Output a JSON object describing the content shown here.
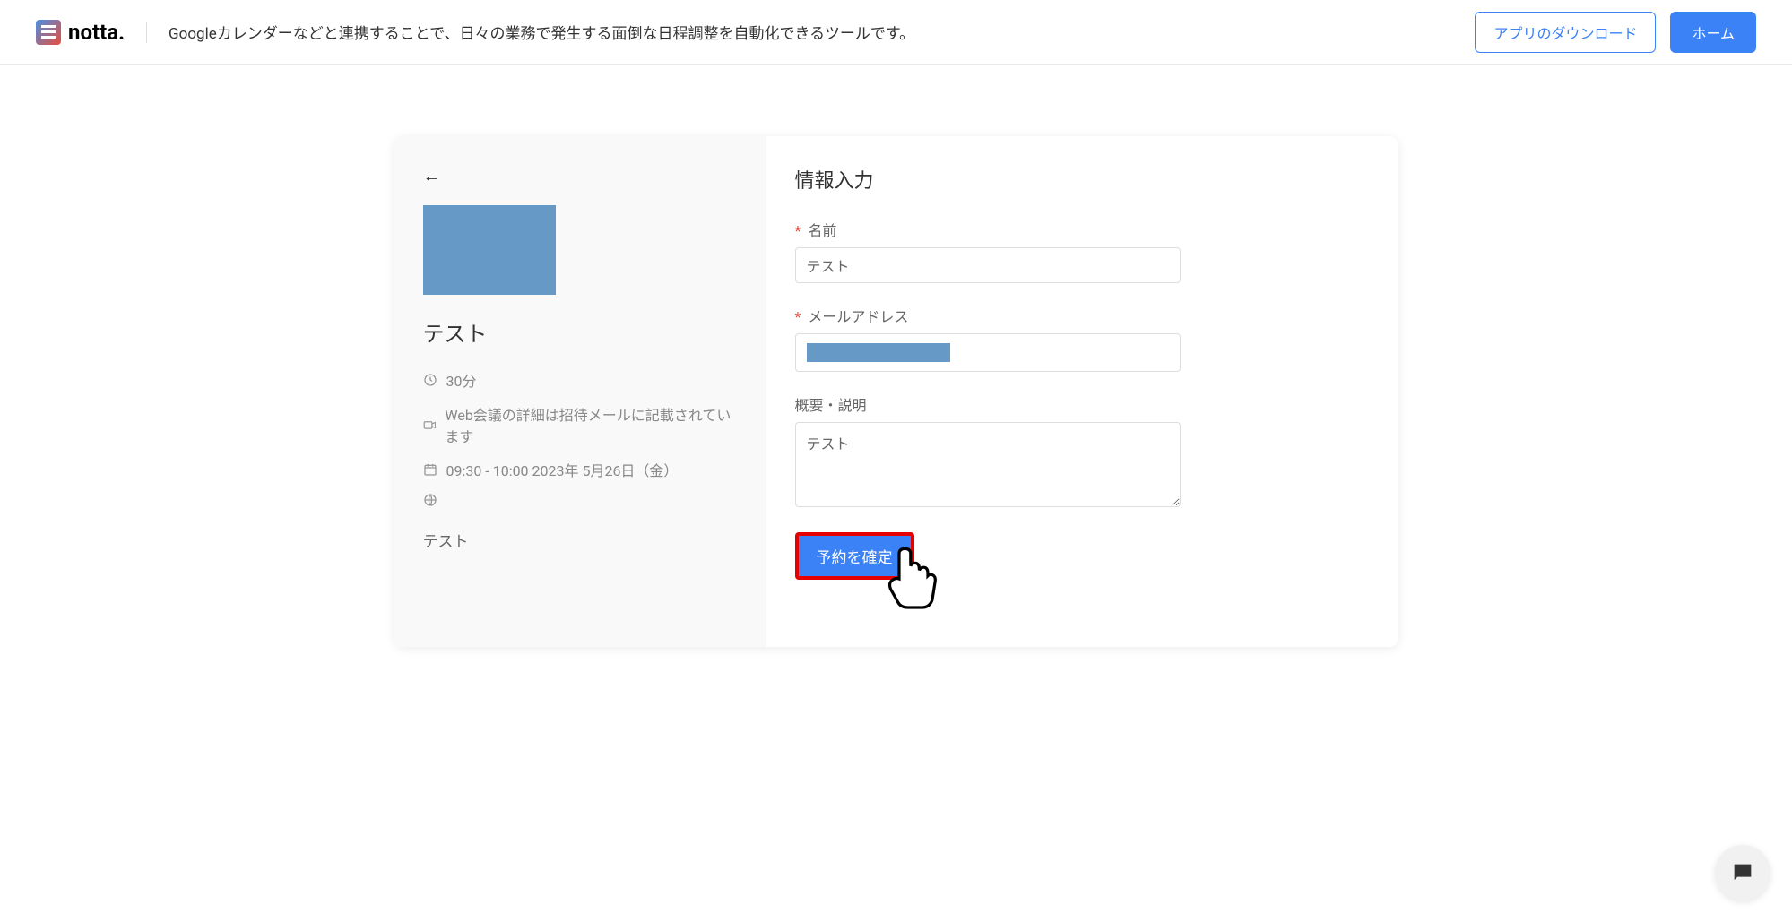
{
  "header": {
    "brand": "notta.",
    "tagline": "Googleカレンダーなどと連携することで、日々の業務で発生する面倒な日程調整を自動化できるツールです。",
    "download_label": "アプリのダウンロード",
    "home_label": "ホーム"
  },
  "sidebar": {
    "event_title": "テスト",
    "duration": "30分",
    "meeting_info": "Web会議の詳細は招待メールに記載されています",
    "datetime": "09:30 - 10:00 2023年 5月26日（金）",
    "description": "テスト"
  },
  "form": {
    "title": "情報入力",
    "name_label": "名前",
    "name_value": "テスト",
    "email_label": "メールアドレス",
    "summary_label": "概要・説明",
    "summary_value": "テスト",
    "submit_label": "予約を確定"
  }
}
